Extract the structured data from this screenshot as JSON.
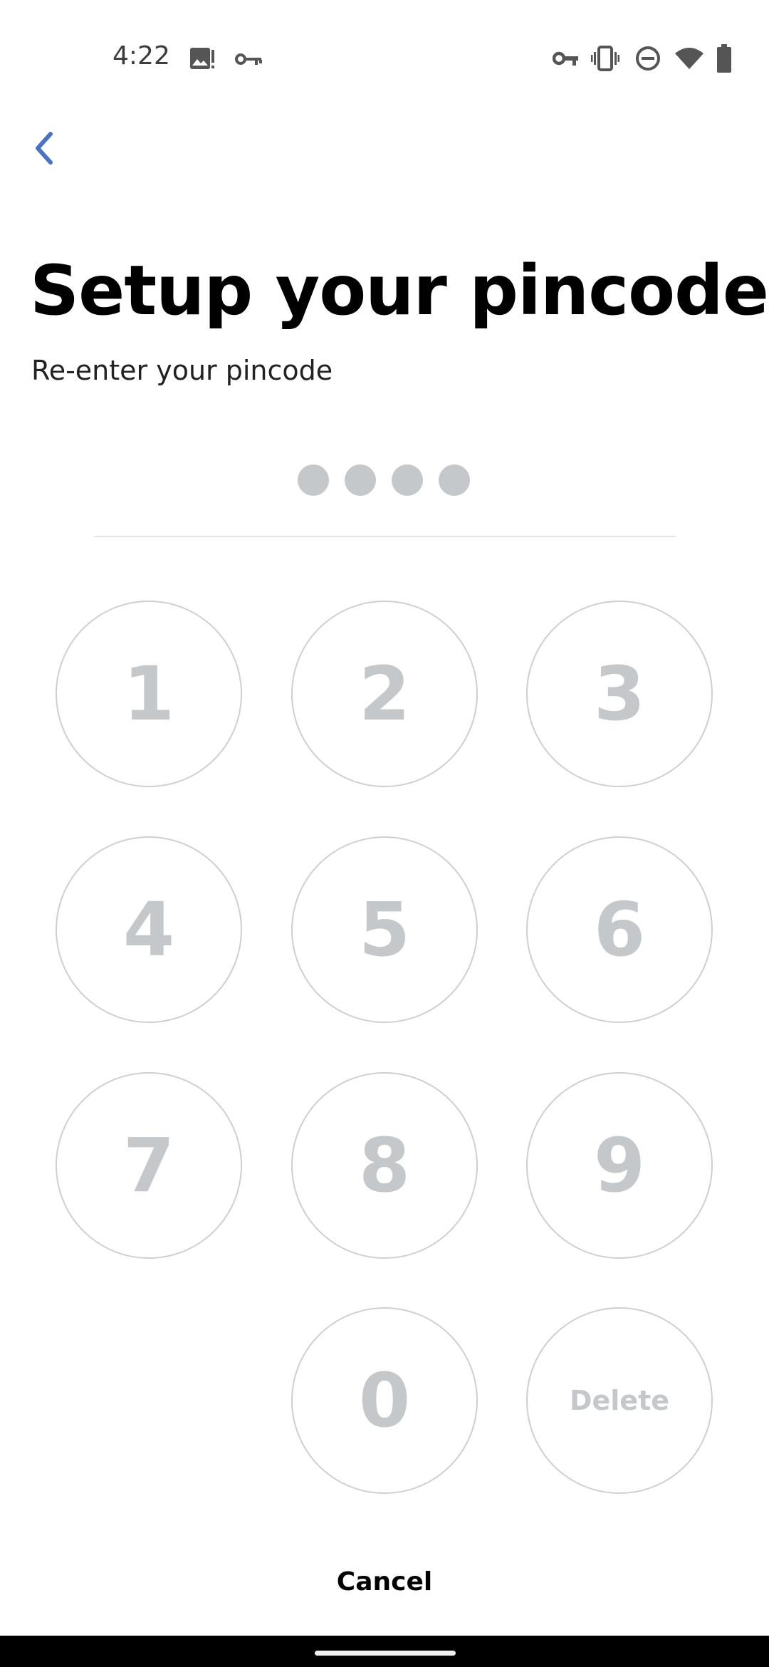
{
  "status_bar": {
    "time": "4:22",
    "icons_left": [
      "image-notification-icon",
      "vpn-key-icon"
    ],
    "icons_right": [
      "vpn-key-icon",
      "vibrate-icon",
      "do-not-disturb-icon",
      "wifi-icon",
      "battery-icon"
    ]
  },
  "header": {
    "back_icon": "chevron-left-icon",
    "title": "Setup your pincode",
    "subtitle": "Re-enter your pincode"
  },
  "pin": {
    "length": 4,
    "entered": 0
  },
  "keypad": {
    "keys": [
      "1",
      "2",
      "3",
      "4",
      "5",
      "6",
      "7",
      "8",
      "9",
      "0"
    ],
    "delete_label": "Delete"
  },
  "footer": {
    "cancel_label": "Cancel"
  },
  "colors": {
    "accent": "#4a73c4",
    "key_text": "#c4c8cb",
    "key_border": "#cfcfcf",
    "dot": "#c4c8cb"
  }
}
